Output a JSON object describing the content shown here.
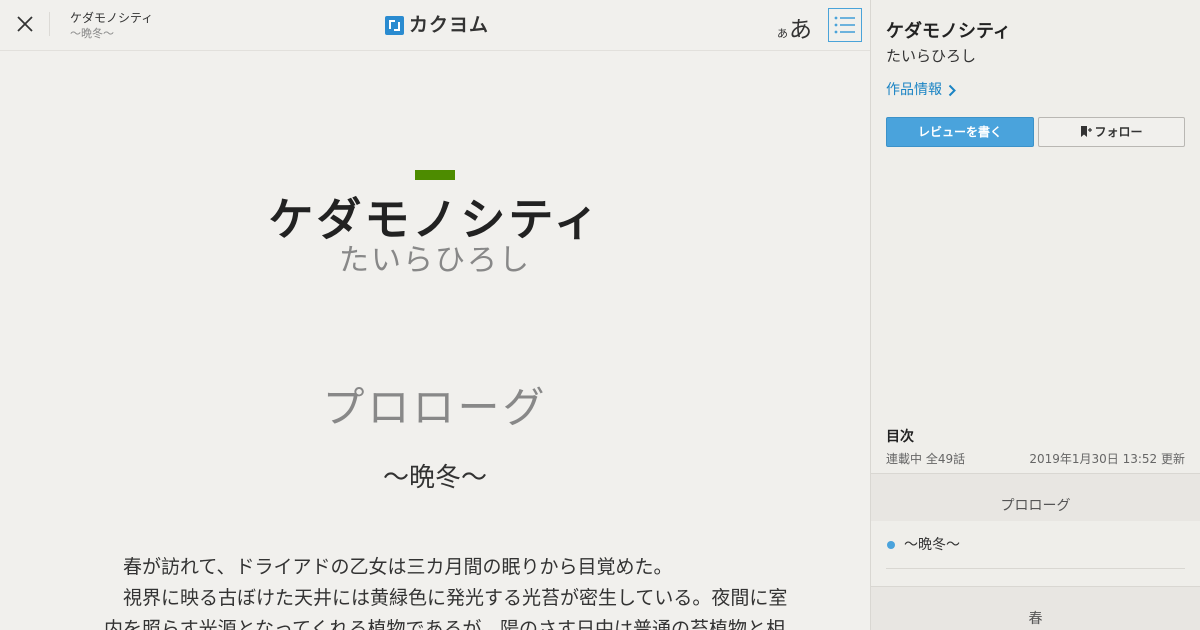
{
  "header": {
    "work_title": "ケダモノシティ",
    "episode_title": "～晩冬～",
    "logo_text": "カクヨム",
    "font_small": "あ",
    "font_large": "あ"
  },
  "reader": {
    "title": "ケダモノシティ",
    "author": "たいらひろし",
    "chapter": "プロローグ",
    "episode": "～晩冬～",
    "paragraphs": [
      "　春が訪れて、ドライアドの乙女は三カ月間の眠りから目覚めた。",
      "　視界に映る古ぼけた天井には黄緑色に発光する光苔が密生している。夜間に室",
      "内を照らす光源となってくれる植物であるが、陽のさす日中は普通の苔植物と相"
    ]
  },
  "sidebar": {
    "title": "ケダモノシティ",
    "author": "たいらひろし",
    "info_link": "作品情報",
    "review_button": "レビューを書く",
    "follow_button": "フォロー",
    "toc_heading": "目次",
    "status": "連載中 全49話",
    "updated": "2019年1月30日 13:52 更新",
    "chapters": [
      {
        "title": "プロローグ",
        "episodes": [
          "～晩冬～"
        ]
      },
      {
        "title": "春",
        "episodes": []
      }
    ]
  },
  "colors": {
    "accent_blue": "#4aa3dc",
    "link_blue": "#1b84c4",
    "title_bar_green": "#4d8c00",
    "background": "#f1f0ed"
  },
  "icons": [
    "close-icon",
    "kakuyomu-logo-icon",
    "toc-list-icon",
    "chevron-right-icon",
    "bookmark-plus-icon"
  ]
}
